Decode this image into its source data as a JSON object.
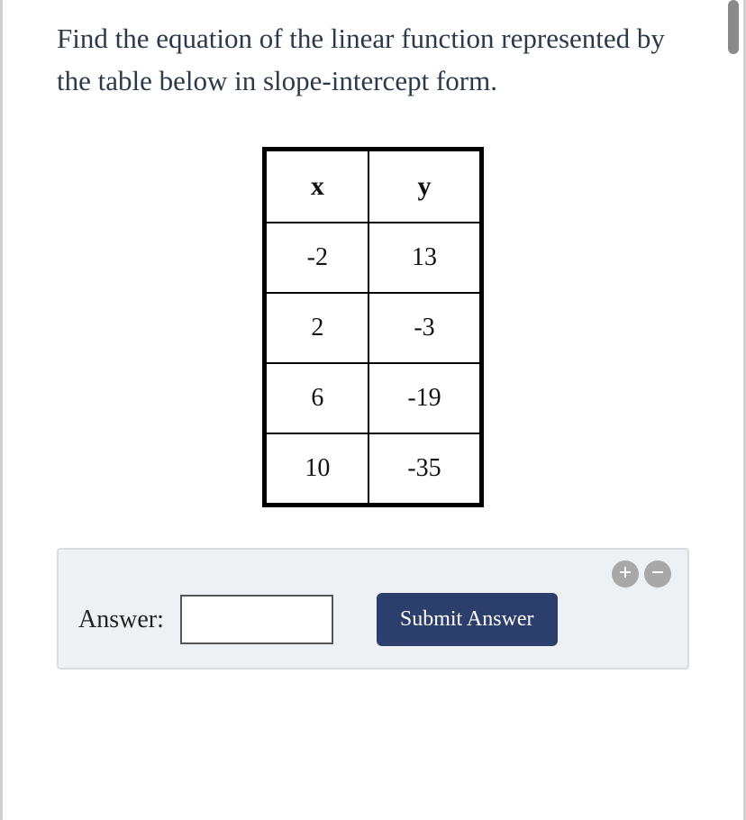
{
  "prompt": "Find the equation of the linear function represented by the table below in slope-intercept form.",
  "table": {
    "headers": {
      "x": "x",
      "y": "y"
    },
    "rows": [
      {
        "x": "-2",
        "y": "13"
      },
      {
        "x": "2",
        "y": "-3"
      },
      {
        "x": "6",
        "y": "-19"
      },
      {
        "x": "10",
        "y": "-35"
      }
    ]
  },
  "answer": {
    "label": "Answer:",
    "value": "",
    "submit_label": "Submit Answer"
  },
  "chart_data": {
    "type": "table",
    "columns": [
      "x",
      "y"
    ],
    "rows": [
      [
        -2,
        13
      ],
      [
        2,
        -3
      ],
      [
        6,
        -19
      ],
      [
        10,
        -35
      ]
    ]
  }
}
